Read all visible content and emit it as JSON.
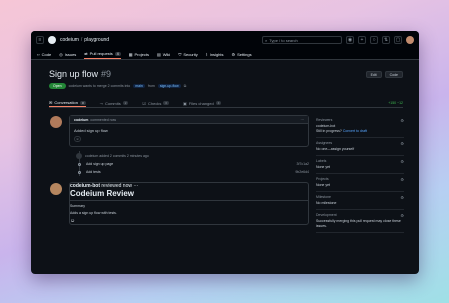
{
  "header": {
    "owner": "codeium",
    "repo": "playground",
    "search_placeholder": "Type / to search"
  },
  "tabs": [
    {
      "label": "Code",
      "icon": "code-icon"
    },
    {
      "label": "Issues",
      "icon": "issue-icon"
    },
    {
      "label": "Pull requests",
      "icon": "pull-request-icon",
      "count": "4",
      "active": true
    },
    {
      "label": "Projects",
      "icon": "projects-icon"
    },
    {
      "label": "Wiki",
      "icon": "wiki-icon"
    },
    {
      "label": "Security",
      "icon": "shield-icon"
    },
    {
      "label": "Insights",
      "icon": "graph-icon"
    },
    {
      "label": "Settings",
      "icon": "gear-icon"
    }
  ],
  "pr": {
    "title": "Sign up flow",
    "number": "#9",
    "state": "Open",
    "summary": "codeium wants to merge 2 commits into",
    "base_branch": "main",
    "from_word": "from",
    "head_branch": "sign-up-flow",
    "edit_label": "Edit",
    "code_label": "Code"
  },
  "pr_tabs": [
    {
      "label": "Conversation",
      "count": "3",
      "active": true
    },
    {
      "label": "Commits",
      "count": "2"
    },
    {
      "label": "Checks",
      "count": "0"
    },
    {
      "label": "Files changed",
      "count": "4"
    }
  ],
  "diffstat": "+150 −12",
  "first_comment": {
    "author": "codeium",
    "meta": "commented now",
    "body": "Added sign up flow"
  },
  "event": {
    "text": "codeium added 2 commits 2 minutes ago"
  },
  "commits": [
    {
      "message": "Add sign up page",
      "sha": "3f7c1a2"
    },
    {
      "message": "Add tests",
      "sha": "9b2e6d4"
    }
  ],
  "review": {
    "author": "codeium-bot",
    "meta": "reviewed now",
    "heading": "Codeium Review",
    "subheading": "Summary",
    "body": "Adds a sign up flow with tests."
  },
  "sidebar": [
    {
      "title": "Reviewers",
      "value": "codeium-bot",
      "extra": "Still in progress?",
      "link": "Convert to draft"
    },
    {
      "title": "Assignees",
      "value": "No one—assign yourself"
    },
    {
      "title": "Labels",
      "value": "None yet"
    },
    {
      "title": "Projects",
      "value": "None yet"
    },
    {
      "title": "Milestone",
      "value": "No milestone"
    },
    {
      "title": "Development",
      "value": "Successfully merging this pull request may close these issues."
    }
  ]
}
